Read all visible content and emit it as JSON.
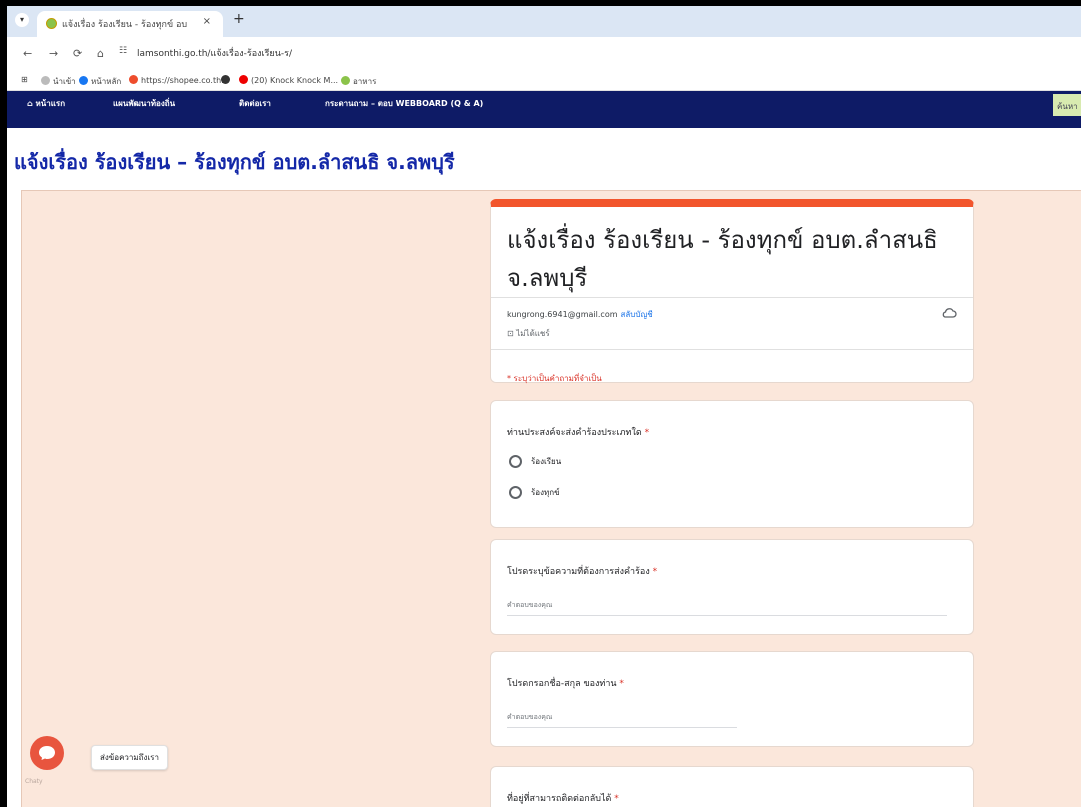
{
  "browser": {
    "tab_title": "แจ้งเรื่อง ร้องเรียน - ร้องทุกข์ อบต.ลำสนธิ",
    "tab_close": "×",
    "new_tab": "+",
    "url": "lamsonthi.go.th/แจ้งเรื่อง-ร้องเรียน-ร/",
    "bookmarks": [
      "นำเข้า",
      "หน้าหลัก",
      "https://shopee.co.th...",
      "(20) Knock Knock M...",
      "อาหาร"
    ]
  },
  "site_nav": {
    "items": [
      "หน้าแรก",
      "แผนพัฒนาท้องถิ่น",
      "ติดต่อเรา",
      "กระดานถาม – ตอบ WEBBOARD (Q & A)"
    ],
    "right_button": "ค้นหา"
  },
  "page": {
    "title": "แจ้งเรื่อง ร้องเรียน – ร้องทุกข์ อบต.ลำสนธิ จ.ลพบุรี"
  },
  "form": {
    "title": "แจ้งเรื่อง ร้องเรียน - ร้องทุกข์ อบต.ลำสนธิ จ.ลพบุรี",
    "account_email": "kungrong.6941@gmail.com",
    "switch_account": "สลับบัญชี",
    "not_shared": "ไม่ได้แชร์",
    "required_note": "* ระบุว่าเป็นคำถามที่จำเป็น",
    "questions": [
      {
        "title": "ท่านประสงค์จะส่งคำร้องประเภทใด",
        "required_mark": "*",
        "options": [
          "ร้องเรียน",
          "ร้องทุกข์"
        ]
      },
      {
        "title": "โปรดระบุข้อความที่ต้องการส่งคำร้อง",
        "required_mark": "*",
        "placeholder": "คำตอบของคุณ"
      },
      {
        "title": "โปรดกรอกชื่อ-สกุล ของท่าน",
        "required_mark": "*",
        "placeholder": "คำตอบของคุณ"
      },
      {
        "title": "ที่อยู่ที่สามารถติดต่อกลับได้",
        "required_mark": "*"
      }
    ]
  },
  "chat": {
    "label": "ส่งข้อความถึงเรา",
    "under_text": "Chaty"
  },
  "colors": {
    "site_nav_bg": "#0e1b66",
    "page_title": "#1428a8",
    "form_bg": "#fbe7db",
    "form_accent": "#f2552c",
    "chat_button": "#e8553e"
  }
}
